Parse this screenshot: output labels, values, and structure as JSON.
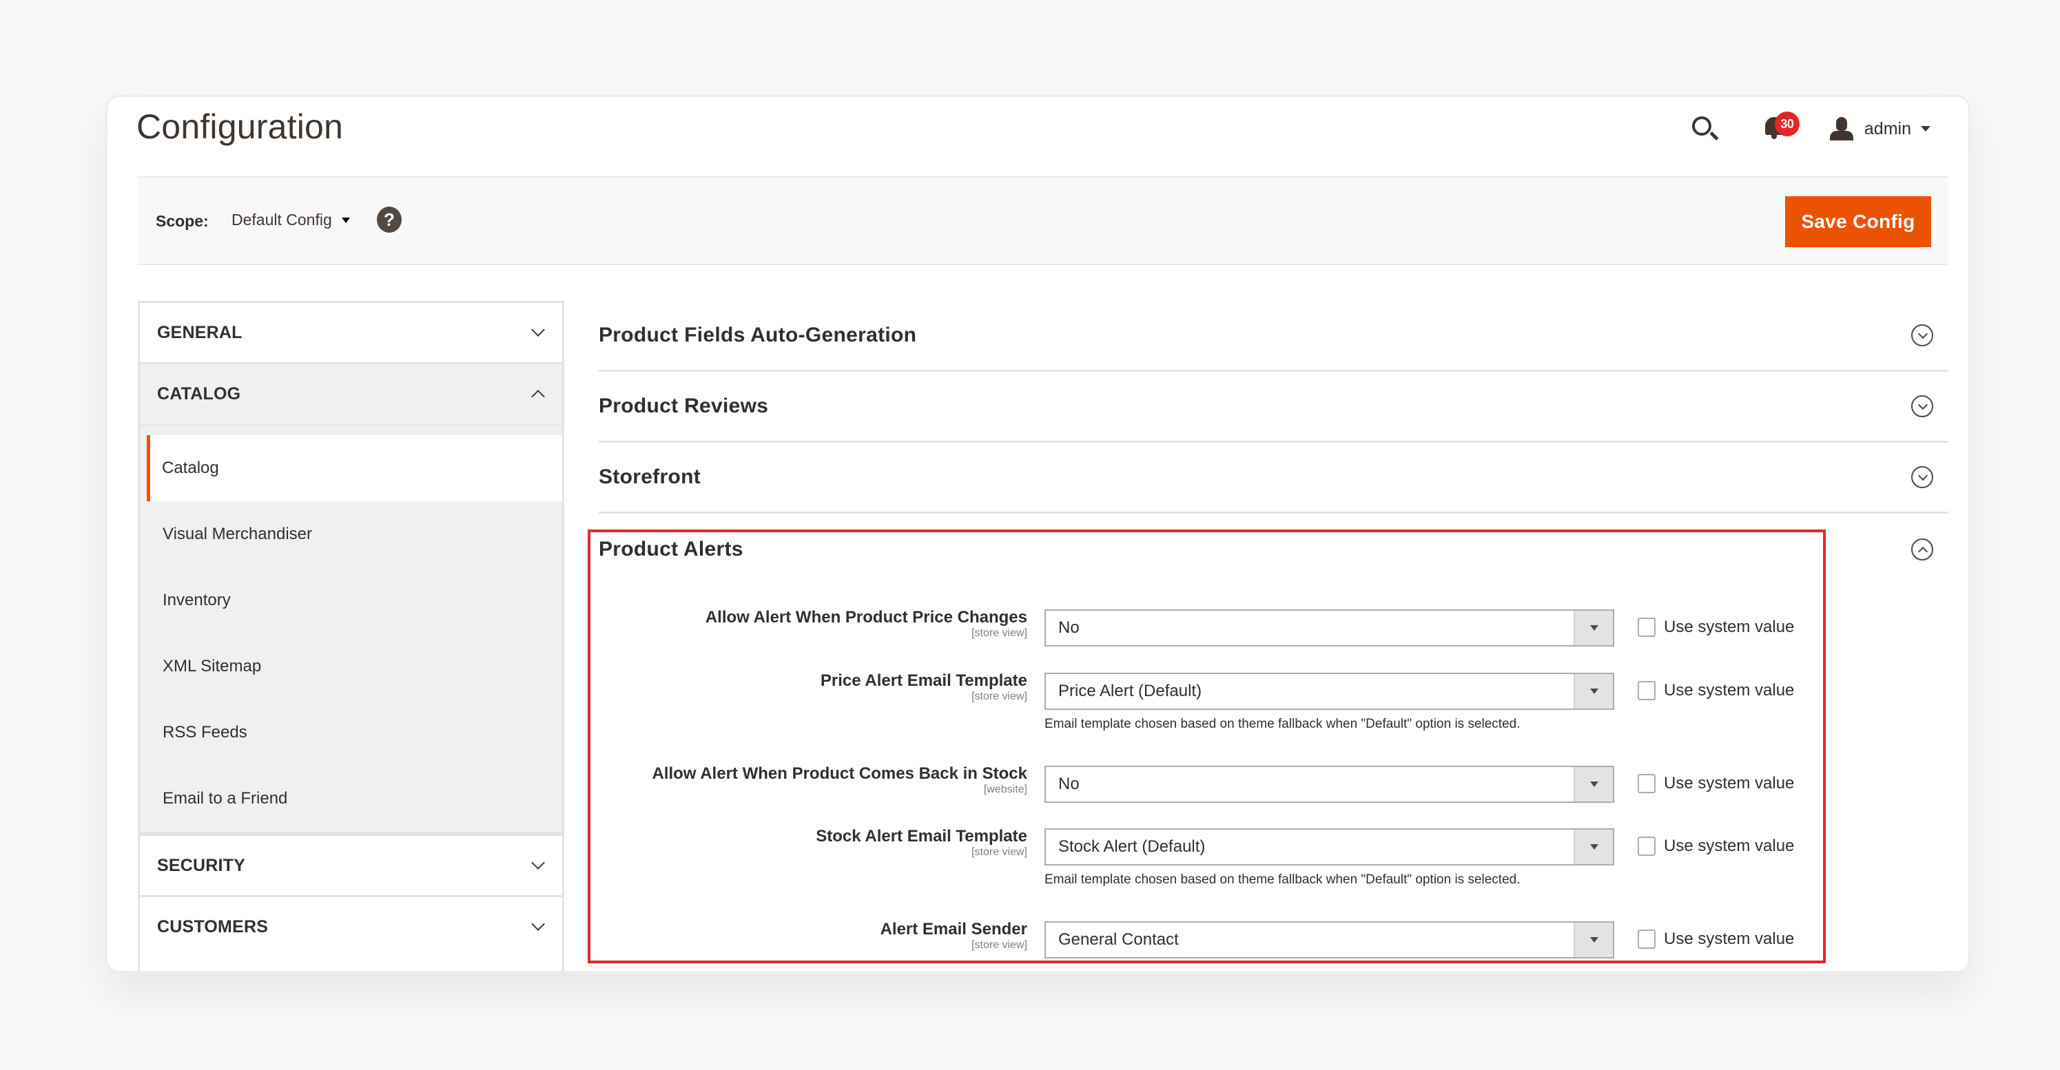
{
  "header": {
    "title": "Configuration",
    "notifications_count": "30",
    "user_name": "admin",
    "icons": {
      "search": "search-icon",
      "notifications": "bell-icon",
      "user": "user-icon"
    }
  },
  "scope_bar": {
    "label": "Scope:",
    "value": "Default Config",
    "help_icon": "?",
    "save_label": "Save Config"
  },
  "colors": {
    "accent": "#eb5202",
    "badge": "#e22626",
    "highlight": "#e02b27"
  },
  "sidebar": {
    "groups": [
      {
        "label": "GENERAL",
        "expanded": false
      },
      {
        "label": "CATALOG",
        "expanded": true,
        "items": [
          {
            "label": "Catalog",
            "active": true
          },
          {
            "label": "Visual Merchandiser",
            "active": false
          },
          {
            "label": "Inventory",
            "active": false
          },
          {
            "label": "XML Sitemap",
            "active": false
          },
          {
            "label": "RSS Feeds",
            "active": false
          },
          {
            "label": "Email to a Friend",
            "active": false
          }
        ]
      },
      {
        "label": "SECURITY",
        "expanded": false
      },
      {
        "label": "CUSTOMERS",
        "expanded": false
      }
    ]
  },
  "sections": [
    {
      "title": "Product Fields Auto-Generation",
      "expanded": false
    },
    {
      "title": "Product Reviews",
      "expanded": false
    },
    {
      "title": "Storefront",
      "expanded": false
    },
    {
      "title": "Product Alerts",
      "expanded": true
    }
  ],
  "product_alerts": {
    "use_system_value_label": "Use system value",
    "fields": [
      {
        "label": "Allow Alert When Product Price Changes",
        "scope": "[store view]",
        "value": "No",
        "use_system_value": false
      },
      {
        "label": "Price Alert Email Template",
        "scope": "[store view]",
        "value": "Price Alert (Default)",
        "use_system_value": false,
        "note": "Email template chosen based on theme fallback when \"Default\" option is selected."
      },
      {
        "label": "Allow Alert When Product Comes Back in Stock",
        "scope": "[website]",
        "value": "No",
        "use_system_value": false
      },
      {
        "label": "Stock Alert Email Template",
        "scope": "[store view]",
        "value": "Stock Alert (Default)",
        "use_system_value": false,
        "note": "Email template chosen based on theme fallback when \"Default\" option is selected."
      },
      {
        "label": "Alert Email Sender",
        "scope": "[store view]",
        "value": "General Contact",
        "use_system_value": false
      }
    ]
  }
}
